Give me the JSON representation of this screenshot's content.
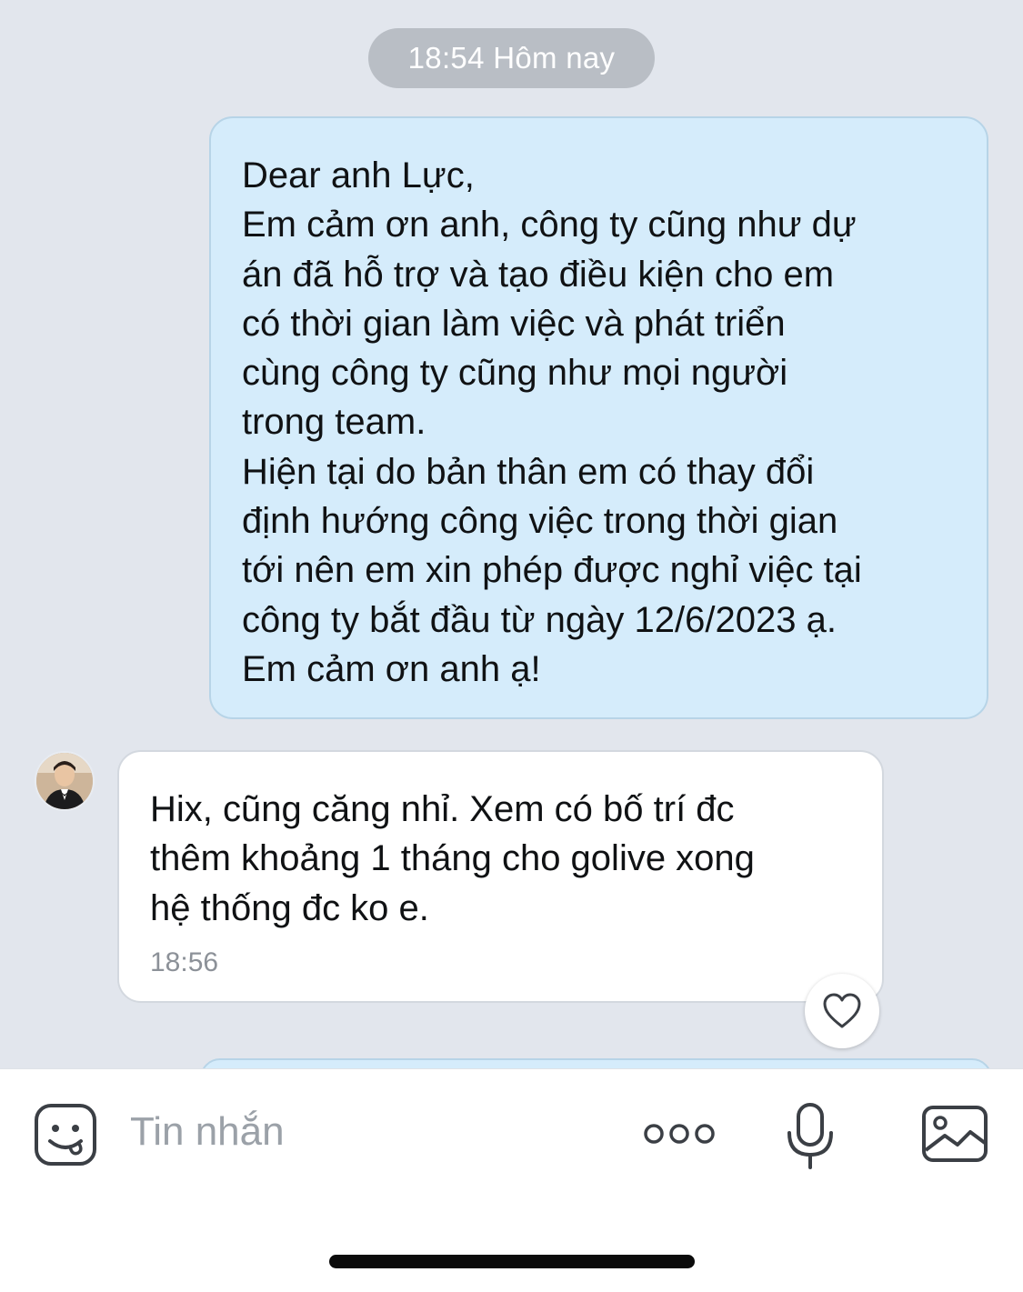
{
  "timestamp_pill": "18:54 Hôm nay",
  "outgoing_message": {
    "lines": [
      "Dear anh Lực,",
      "Em cảm ơn anh, công ty cũng như dự",
      "án đã hỗ trợ và tạo điều kiện cho em",
      "có thời gian làm việc và phát triển",
      "cùng công ty cũng như mọi người",
      "trong team.",
      "Hiện tại do bản thân em có thay đổi",
      "định hướng công việc trong thời gian",
      "tới nên em xin phép được nghỉ việc tại",
      "công ty bắt đầu từ ngày 12/6/2023 ạ.",
      "Em cảm ơn anh ạ!"
    ]
  },
  "incoming_message": {
    "lines": [
      "Hix, cũng căng nhỉ. Xem có bố trí đc",
      "thêm khoảng 1 tháng cho golive xong",
      "hệ thống đc ko e."
    ],
    "time": "18:56"
  },
  "input_bar": {
    "placeholder": "Tin nhắn",
    "icons": [
      "sticker-icon",
      "more-icon",
      "microphone-icon",
      "image-icon"
    ]
  },
  "colors": {
    "chat_background": "#e2e6ed",
    "outgoing_bubble": "#d5ecfb",
    "incoming_bubble": "#ffffff",
    "timestamp_pill": "#b9bec5"
  }
}
